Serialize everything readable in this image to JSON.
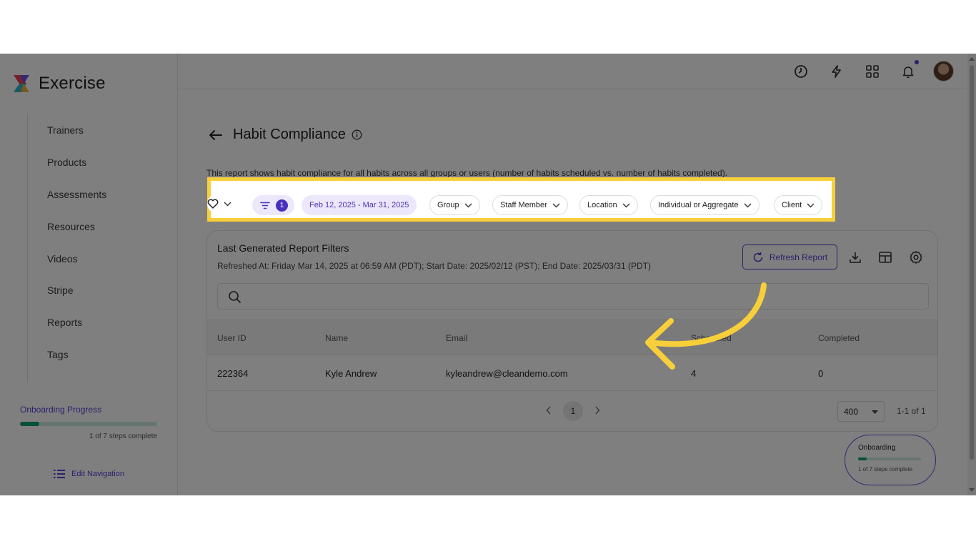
{
  "app": {
    "name": "Exercise"
  },
  "sidebar": {
    "items": [
      {
        "label": "Trainers"
      },
      {
        "label": "Products"
      },
      {
        "label": "Assessments"
      },
      {
        "label": "Resources"
      },
      {
        "label": "Videos"
      },
      {
        "label": "Stripe"
      },
      {
        "label": "Reports"
      },
      {
        "label": "Tags"
      }
    ],
    "onboarding": {
      "title": "Onboarding Progress",
      "steps": "1 of 7 steps complete",
      "progress": 0.14
    },
    "edit_nav_label": "Edit Navigation"
  },
  "topbar": {
    "icons": [
      "clock-icon",
      "lightning-icon",
      "grid-icon",
      "bell-icon"
    ],
    "notification_dot_color": "#5b3fd6"
  },
  "page": {
    "title": "Habit Compliance",
    "description": "This report shows habit compliance for all habits across all groups or users (number of habits scheduled vs. number of habits completed)."
  },
  "filters": {
    "active_count": "1",
    "date_range": "Feb 12, 2025 - Mar 31, 2025",
    "group": "Group",
    "staff_member": "Staff Member",
    "location": "Location",
    "individual_or_aggregate": "Individual or Aggregate",
    "client": "Client",
    "highlight_color": "#f7cf3a"
  },
  "report": {
    "title": "Last Generated Report Filters",
    "subtitle": "Refreshed At: Friday Mar 14, 2025 at 06:59 AM (PDT); Start Date: 2025/02/12 (PST); End Date: 2025/03/31 (PDT)",
    "refresh_label": "Refresh Report",
    "search_placeholder": "",
    "columns": [
      "User ID",
      "Name",
      "Email",
      "Scheduled",
      "Completed"
    ],
    "rows": [
      {
        "user_id": "222364",
        "name": "Kyle Andrew",
        "email": "kyleandrew@cleandemo.com",
        "scheduled": "4",
        "completed": "0"
      }
    ],
    "pagination": {
      "current_page": "1",
      "per_page": "400",
      "range": "1-1 of 1"
    }
  },
  "onboarding_widget": {
    "title": "Onboarding",
    "steps": "1 of 7 steps complete",
    "progress": 0.14
  },
  "colors": {
    "accent": "#5b3fd6",
    "progress": "#14a06a",
    "arrow": "#f7cf3a"
  }
}
